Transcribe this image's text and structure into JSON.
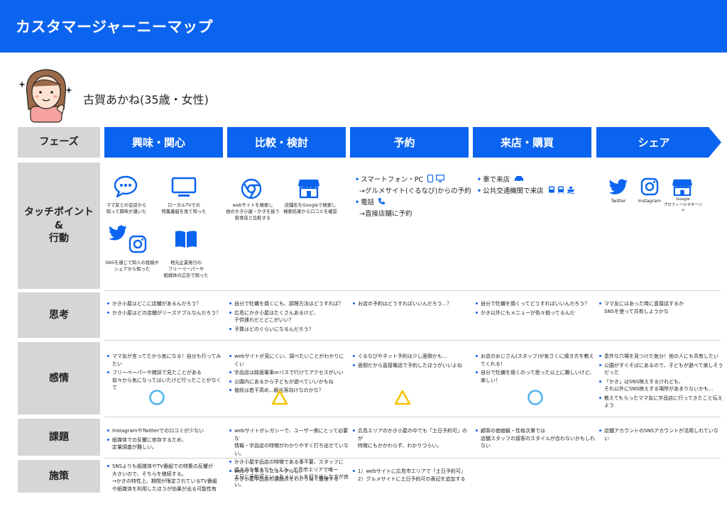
{
  "header": {
    "title": "カスタマージャーニーマップ"
  },
  "persona": {
    "name": "古賀あかね(35歳・女性)"
  },
  "labels": {
    "phase": "フェーズ",
    "touchpoint": "タッチポイント\n&\n行動",
    "thought": "思考",
    "emotion": "感情",
    "issue": "課題",
    "measure": "施策"
  },
  "phases": [
    "興味・関心",
    "比較・検討",
    "予約",
    "来店・購買",
    "シェア"
  ],
  "touchpoints": {
    "col1": {
      "chat": "ママ友との会話から\n知って興味が湧いた",
      "tv": "ローカルTVでの\n特集番組を見て知った",
      "sns": "SNSを通じて知人の投稿や\nシェアから知った",
      "book": "地元企業発行の\nフリーペーパーや\n紙媒体の広告で知った"
    },
    "col2": {
      "chrome": "webサイトを検索し\n他のかき小屋・かきを扱う\n飲食店と比較する",
      "store": "店舗名をGoogleで検索し\n検索結果から口コミを確認"
    },
    "col3": {
      "line1": "スマートフォン・PC",
      "line2": "→グルメサイト(ぐるなび)からの予約",
      "line3": "電話",
      "line4": "→直接店舗に予約"
    },
    "col4": {
      "line1": "車で来店",
      "line2": "公共交通機関で来店"
    },
    "col5": {
      "twitter": "Twitter",
      "instagram": "Instagram",
      "google": "Google\nプロフィールマネージャ"
    }
  },
  "thoughts": [
    [
      "かき小屋はどこに店舗があるんだろう？",
      "かき小屋はどの店舗がリーズナブルなんだろう？"
    ],
    [
      "自分で牡蠣を焼くにも、調理方法はどうすれば？",
      "広島にかき小屋はたくさんあるけど、\n子供連れだとどこがいい？",
      "予算はどのぐらいになるんだろう？"
    ],
    [
      "お店の予約はどうすればいいんだろう...？"
    ],
    [
      "自分で牡蠣を焼くってどうすればいいんだろう？",
      "かき以外にもメニューが色々揃ってるんだ"
    ],
    [
      "ママ友にはあった時に直接話するか\nSNSを使って共有しようかな"
    ]
  ],
  "emotions": [
    [
      "ママ友が言ってたから気になる！自分も行ってみたい",
      "フリーペーパーや雑誌で見たことがある\n前々から気になってはいたけど行ったことがなくて"
    ],
    [
      "webサイトが見にくい、調べたいことがわかりにくい",
      "宇品店は路面電車orバスで行けてアクセスがいい",
      "公園内にあるから子どもが遊べていいかもね",
      "値段は若干高め...観光客向けなのかな？"
    ],
    [
      "ぐるなびやネット予約は少し面倒かも...",
      "面倒だから直接電話で予約したほうがいいよね"
    ],
    [
      "お店のおじさん(スタッフ)が気さくに焼き方を教えてくれる！",
      "自分で牡蠣を焼くのって思った以上に難しいけど、楽しい！"
    ],
    [
      "意外な穴場を見つけた気分！他の人にも共有したい",
      "公園がすぐそばにあるので、子どもが遊べて楽しそうだった",
      "「かき」はSNS映えするけれども、\nそれ以外にSNS映えする場所があまりないかも...",
      "教えてもらったママ友に宇品店に行ってきたこと伝えよう"
    ]
  ],
  "emotion_marks": [
    "circle",
    "triangle",
    "triangle",
    "circle",
    "none"
  ],
  "issues": [
    [
      "InstagramやTwitterでの口コミが少ない",
      "紙媒体での反響に依存するため、\n定量調査が難しい。"
    ],
    [
      "webサイトがレガシーで、ユーザー側にとって必要な\n情報・宇品店の特徴がわかりやすく打ち出せていない。",
      "かき小屋宇品店の特徴である事不要、スタッフに\n焼き方を教えてもらえる、広島市エリアで唯一\n土日に予約可といったメリットを打ち出した方が良い。"
    ],
    [
      "広島エリアのかき小屋の中でも「土日予約可」のが\n特徴にもかかわらず、わかりづらい。"
    ],
    [
      "顧客の価値観・性格次第では\n店舗スタッフの接客のスタイルが合わないかもしれない"
    ],
    [
      "店舗アカウントのSNSアカウントが活用しれていない"
    ]
  ],
  "measures": [
    [
      "SNSよりも紙媒体やTV番組での特集の反響が\n大きいので、そちらを継続する。\n→かきの特性上、期間が限定されているTV番組\nや紙媒体を利用したほうが効果が出る可能性有"
    ],
    [
      "webサイトをリニューアルし、\nかき小屋宇品店の課題点をわかり易く整理する"
    ],
    [
      "1）webサイトに広島市エリアで「土日予約可」\n2）グルメサイトに土日予約可の表記を追加する"
    ],
    [],
    []
  ],
  "colors": {
    "brand": "#0b64ef",
    "label_bg": "#d6d6d6",
    "circle_mark": "#54b4ee",
    "triangle_mark": "#f5c400"
  }
}
